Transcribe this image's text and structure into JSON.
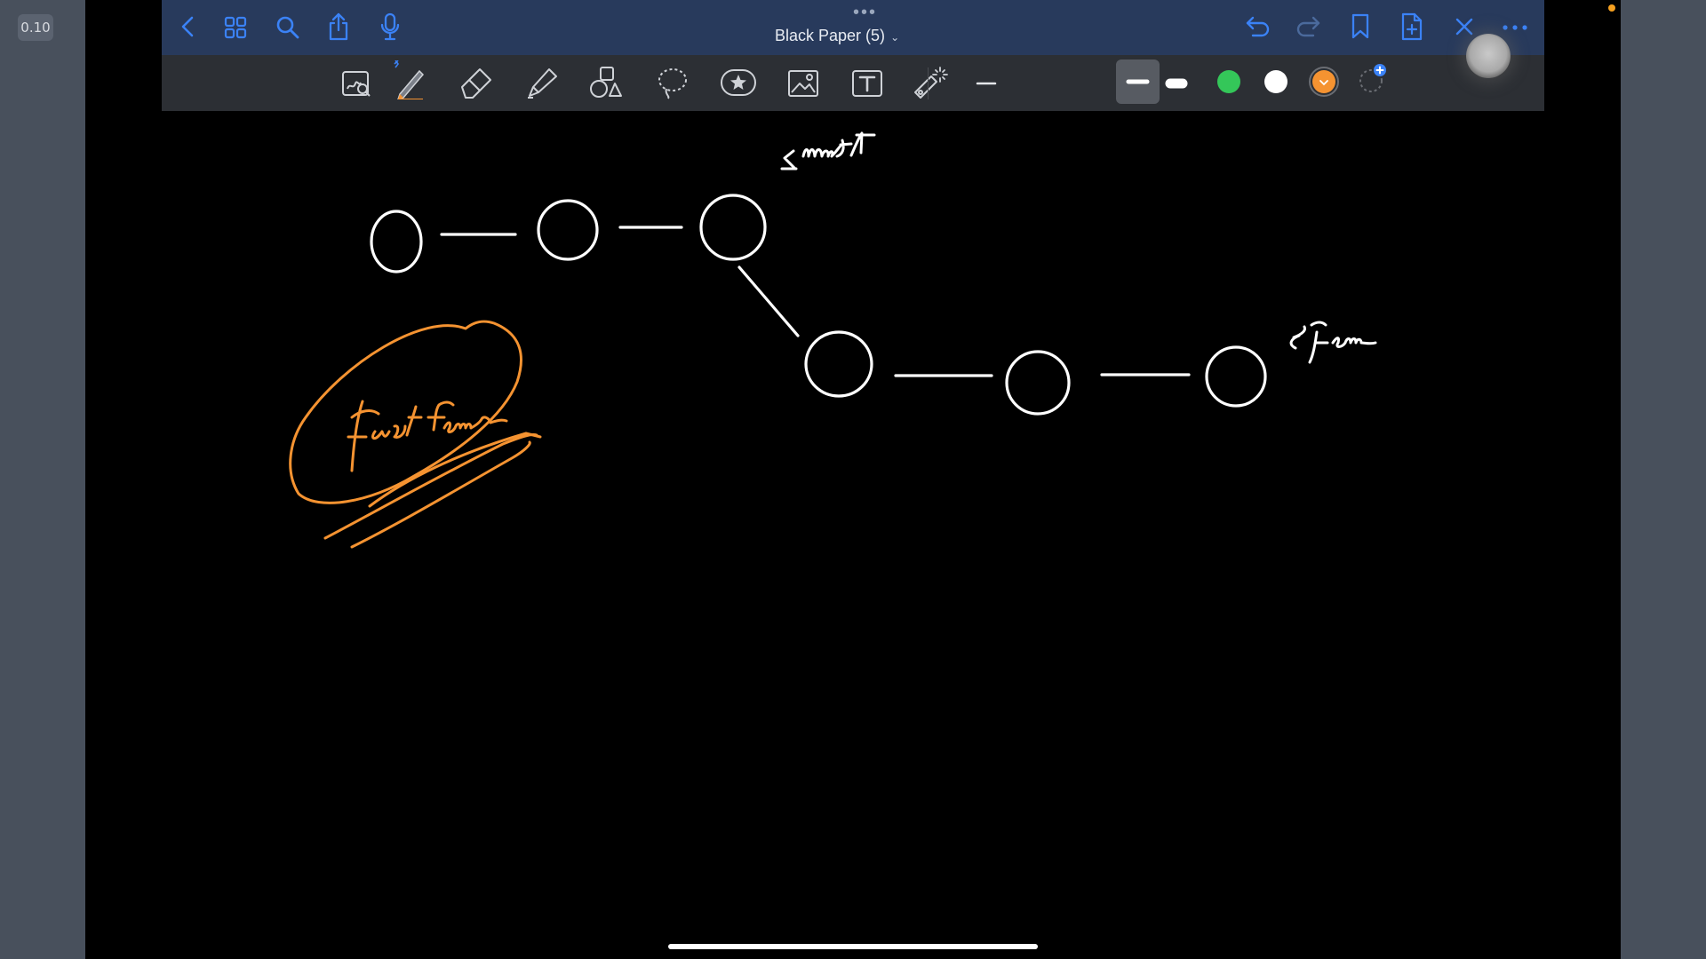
{
  "timestamp_badge": "0.10",
  "app": {
    "document_title": "Black Paper (5)",
    "title_chevron": "⌄",
    "accent_color": "#3b82f6"
  },
  "nav_icons": [
    "back-icon",
    "grid-view-icon",
    "search-icon",
    "share-icon",
    "microphone-icon"
  ],
  "right_icons": [
    "undo-icon",
    "redo-icon",
    "bookmark-icon",
    "add-page-icon",
    "close-icon",
    "more-icon"
  ],
  "tools": [
    "lasso-zoom-icon",
    "pen-icon",
    "eraser-icon",
    "highlighter-icon",
    "shapes-icon",
    "lasso-icon",
    "sticker-icon",
    "image-icon",
    "text-icon",
    "laser-pointer-icon"
  ],
  "stroke_widths": [
    "thin",
    "medium",
    "thick"
  ],
  "colors": [
    "#34c759",
    "#ffffff",
    "#f59331"
  ],
  "canvas": {
    "background": "#000000",
    "ink_colors": {
      "white": "#ffffff",
      "orange": "#f59331"
    }
  }
}
